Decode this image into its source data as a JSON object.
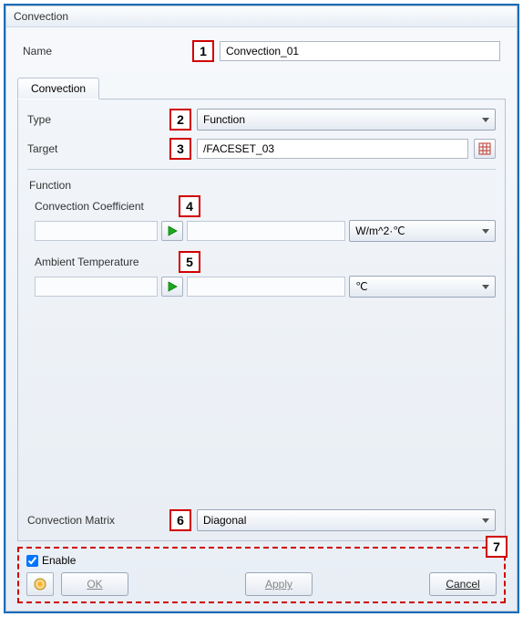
{
  "window": {
    "title": "Convection"
  },
  "name": {
    "label": "Name",
    "value": "Convection_01"
  },
  "tabs": [
    {
      "label": "Convection"
    }
  ],
  "type": {
    "label": "Type",
    "value": "Function"
  },
  "target": {
    "label": "Target",
    "value": "/FACESET_03"
  },
  "function": {
    "group_label": "Function",
    "coeff": {
      "label": "Convection Coefficient",
      "value": "",
      "unit": "W/m^2·℃"
    },
    "ambient": {
      "label": "Ambient Temperature",
      "value": "",
      "unit": "℃"
    }
  },
  "matrix": {
    "label": "Convection Matrix",
    "value": "Diagonal"
  },
  "enable": {
    "label": "Enable",
    "checked": true
  },
  "buttons": {
    "ok": "OK",
    "apply": "Apply",
    "cancel": "Cancel"
  },
  "callouts": {
    "c1": "1",
    "c2": "2",
    "c3": "3",
    "c4": "4",
    "c5": "5",
    "c6": "6",
    "c7": "7"
  }
}
